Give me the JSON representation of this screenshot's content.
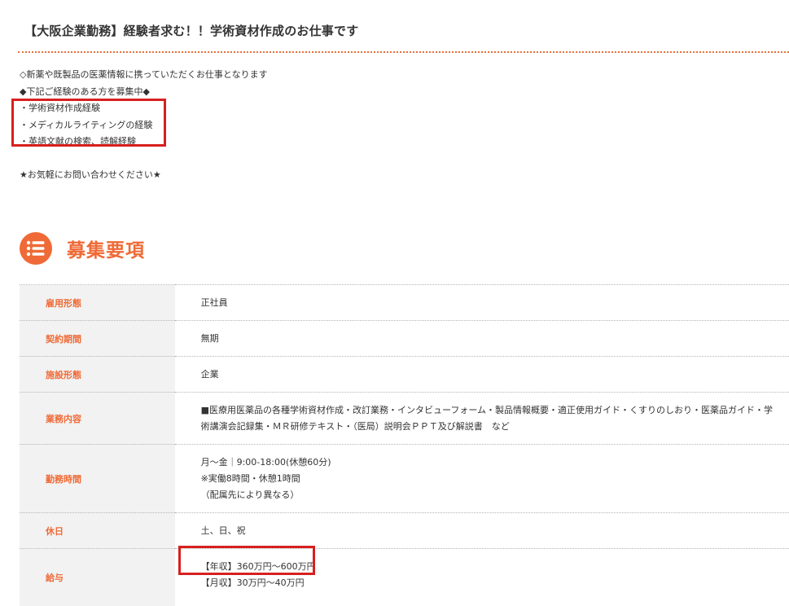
{
  "header": {
    "title": "【大阪企業勤務】経験者求む！！学術資材作成のお仕事です"
  },
  "intro": {
    "lines": [
      "◇新薬や既製品の医薬情報に携っていただくお仕事となります",
      "◆下記ご経験のある方を募集中◆",
      "・学術資材作成経験",
      "・メディカルライティングの経験",
      "・英語文献の検索、読解経験"
    ],
    "closing": "★お気軽にお問い合わせください★"
  },
  "section": {
    "title": "募集要項",
    "icon": "list-icon",
    "accent_color": "#ef6a36"
  },
  "requirements": {
    "employment_type": {
      "label": "雇用形態",
      "value": "正社員"
    },
    "contract_period": {
      "label": "契約期間",
      "value": "無期"
    },
    "facility_type": {
      "label": "施設形態",
      "value": "企業"
    },
    "duties": {
      "label": "業務内容",
      "lines": [
        "■医療用医薬品の各種学術資材作成・改訂業務・インタビューフォーム・製品情報概要・適正使用ガイド・くすりのしおり・医薬品ガイド・学",
        "術講演会記録集・ＭＲ研修テキスト・（医局）説明会ＰＰＴ及び解説書　など"
      ]
    },
    "working_hours": {
      "label": "勤務時間",
      "lines": [
        "月～金｜9:00-18:00(休憩60分)",
        "※実働8時間・休憩1時間",
        "（配属先により異なる）"
      ]
    },
    "holidays": {
      "label": "休日",
      "value": "土、日、祝"
    },
    "salary": {
      "label": "給与",
      "annual": "【年収】360万円～600万円",
      "monthly": "【月収】30万円～40万円"
    }
  },
  "colors": {
    "accent": "#ef6a36",
    "highlight_box": "#d7201f",
    "label_bg": "#f2f2f2"
  }
}
